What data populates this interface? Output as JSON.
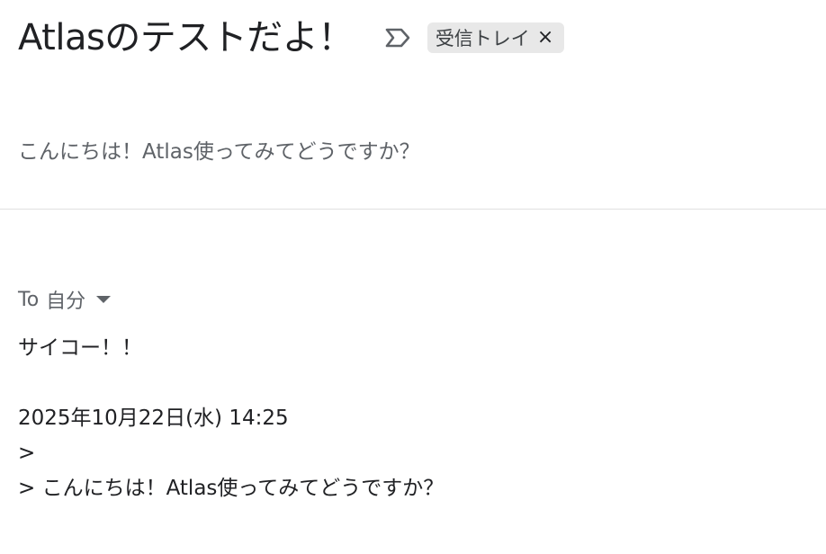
{
  "thread": {
    "subject": "Atlasのテストだよ！",
    "label_chip": "受信トレイ",
    "chip_close": "×",
    "important_icon": "importance-marker-icon"
  },
  "collapsed_message": {
    "snippet": "こんにちは！Atlas使ってみてどうですか？"
  },
  "open_message": {
    "to_label": "To",
    "recipient": "自分",
    "recipient_caret_icon": "caret-down-icon",
    "body_line_1": "サイコー！！",
    "quote_header": "2025年10月22日(水) 14:25",
    "quote_line_1": ">",
    "quote_line_2": "> こんにちは！Atlas使ってみてどうですか？"
  },
  "colors": {
    "subject_text": "#202124",
    "secondary_text": "#5f6368",
    "chip_background": "#e8e8e8",
    "divider": "#e0e0e0"
  }
}
